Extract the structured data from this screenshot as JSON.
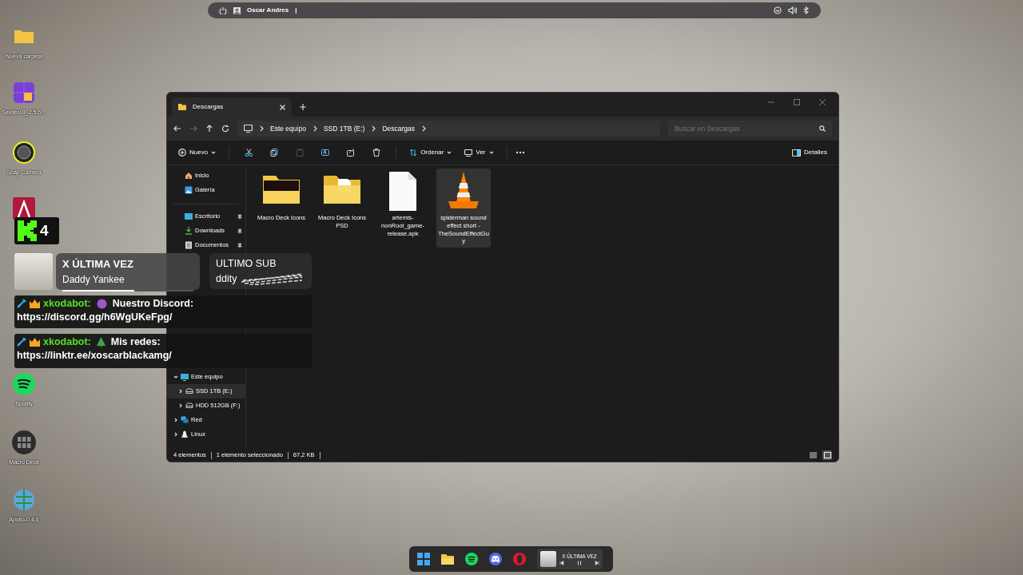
{
  "top_bar": {
    "user": "Oscar Andres",
    "separator": "|"
  },
  "desktop_icons": [
    {
      "kind": "folder",
      "label": "Nueva carpeta"
    },
    {
      "kind": "grid-app",
      "label": "SeelenUI_2.5.6..."
    },
    {
      "kind": "camera",
      "label": "Snap Camera"
    },
    {
      "kind": "red-app"
    },
    {
      "kind": "spotify",
      "label": "Spotify"
    },
    {
      "kind": "macro",
      "label": "Macro Deck"
    },
    {
      "kind": "globe",
      "label": "Apollo-0.4.6"
    }
  ],
  "explorer": {
    "tab_title": "Descargas",
    "breadcrumb": [
      "Este equipo",
      "SSD 1TB (E:)",
      "Descargas"
    ],
    "search": {
      "placeholder": "Buscar en Descargas"
    },
    "new_label": "Nuevo",
    "toolbar_icons": [
      {
        "kind": "cut",
        "disabled": false
      },
      {
        "kind": "copy",
        "disabled": false
      },
      {
        "kind": "paste",
        "disabled": true
      },
      {
        "kind": "rename",
        "disabled": false
      },
      {
        "kind": "share",
        "disabled": false
      },
      {
        "kind": "delete",
        "disabled": false
      }
    ],
    "sort_label": "Ordenar",
    "view_label": "Ver",
    "details_label": "Detalles",
    "quick_access": [
      {
        "label": "Inicio",
        "kind": "home",
        "pinned": false
      },
      {
        "label": "Galería",
        "kind": "gallery",
        "pinned": false
      }
    ],
    "pinned": [
      {
        "label": "Escritorio",
        "kind": "desktop",
        "pinned": true
      },
      {
        "label": "Downloads",
        "kind": "download",
        "pinned": true
      },
      {
        "label": "Documentos",
        "kind": "doc",
        "pinned": true
      }
    ],
    "tree": [
      {
        "label": "Este equipo",
        "kind": "pc",
        "expanded": true,
        "selected": false,
        "children": [
          {
            "label": "SSD 1TB (E:)",
            "kind": "drive",
            "expanded": false,
            "selected": true
          },
          {
            "label": "HDD 512GB (F:)",
            "kind": "drive",
            "expanded": false,
            "selected": false
          }
        ]
      },
      {
        "label": "Red",
        "kind": "network",
        "expanded": false,
        "selected": false
      },
      {
        "label": "Linux",
        "kind": "linux",
        "expanded": false,
        "selected": false
      }
    ],
    "files": [
      {
        "name": "Macro Deck Icons",
        "kind": "folder-dark",
        "selected": false
      },
      {
        "name": "Macro Deck Icons PSD",
        "kind": "folder-doc",
        "selected": false
      },
      {
        "name": "artemis-nonRoot_game-release.apk",
        "kind": "file",
        "selected": false
      },
      {
        "name": "spiderman sound effect short - TheSoundEffectGuy",
        "kind": "vlc",
        "selected": true
      }
    ],
    "status": [
      "4 elementos",
      "1 elemento seleccionado",
      "67,2 KB"
    ],
    "view_modes": [
      {
        "kind": "details",
        "selected": false
      },
      {
        "kind": "tiles",
        "selected": true
      }
    ]
  },
  "kick_badge": {
    "count": "4"
  },
  "now_playing": {
    "title": "X ÚLTIMA VEZ",
    "artist": "Daddy Yankee",
    "level": 0.55
  },
  "last_sub": {
    "heading": "ULTIMO SUB",
    "name": "ddity"
  },
  "chat": [
    {
      "user": "xkodabot:",
      "kind": "purple-circle",
      "text": "Nuestro Discord:",
      "link": "https://discord.gg/h6WgUKeFpg/"
    },
    {
      "user": "xkodabot:",
      "kind": "tree",
      "text": "Mis redes:",
      "link": "https://linktr.ee/xoscarblackamg/"
    }
  ],
  "taskbar": {
    "apps": [
      {
        "kind": "windows"
      },
      {
        "kind": "explorer"
      },
      {
        "kind": "spotify"
      },
      {
        "kind": "discord"
      },
      {
        "kind": "opera"
      }
    ],
    "media_title": "X ÚLTIMA VEZ"
  }
}
